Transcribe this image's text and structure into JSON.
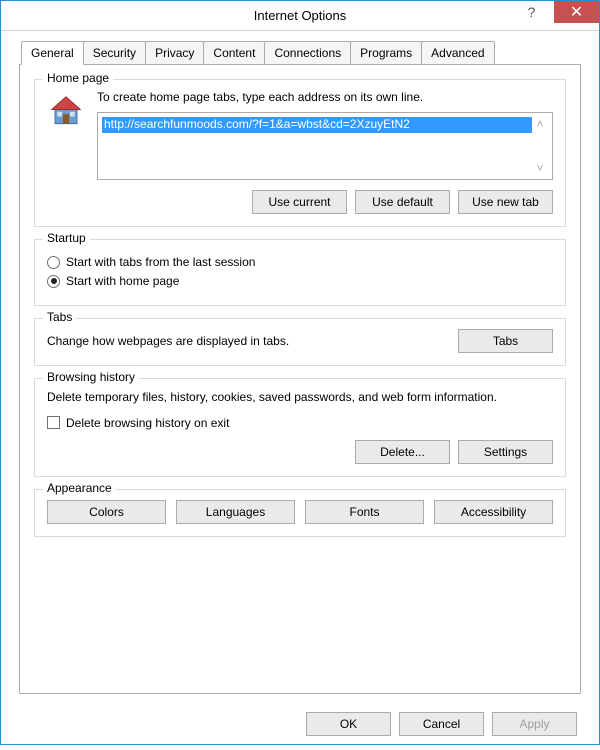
{
  "title": "Internet Options",
  "tabs": {
    "general": "General",
    "security": "Security",
    "privacy": "Privacy",
    "content": "Content",
    "connections": "Connections",
    "programs": "Programs",
    "advanced": "Advanced"
  },
  "homepage": {
    "title": "Home page",
    "desc": "To create home page tabs, type each address on its own line.",
    "url": "http://searchfunmoods.com/?f=1&a=wbst&cd=2XzuyEtN2",
    "use_current": "Use current",
    "use_default": "Use default",
    "use_new_tab": "Use new tab"
  },
  "startup": {
    "title": "Startup",
    "opt_last": "Start with tabs from the last session",
    "opt_home": "Start with home page"
  },
  "tabsGroup": {
    "title": "Tabs",
    "desc": "Change how webpages are displayed in tabs.",
    "btn": "Tabs"
  },
  "history": {
    "title": "Browsing history",
    "desc": "Delete temporary files, history, cookies, saved passwords, and web form information.",
    "checkbox": "Delete browsing history on exit",
    "delete": "Delete...",
    "settings": "Settings"
  },
  "appearance": {
    "title": "Appearance",
    "colors": "Colors",
    "languages": "Languages",
    "fonts": "Fonts",
    "accessibility": "Accessibility"
  },
  "buttons": {
    "ok": "OK",
    "cancel": "Cancel",
    "apply": "Apply"
  }
}
